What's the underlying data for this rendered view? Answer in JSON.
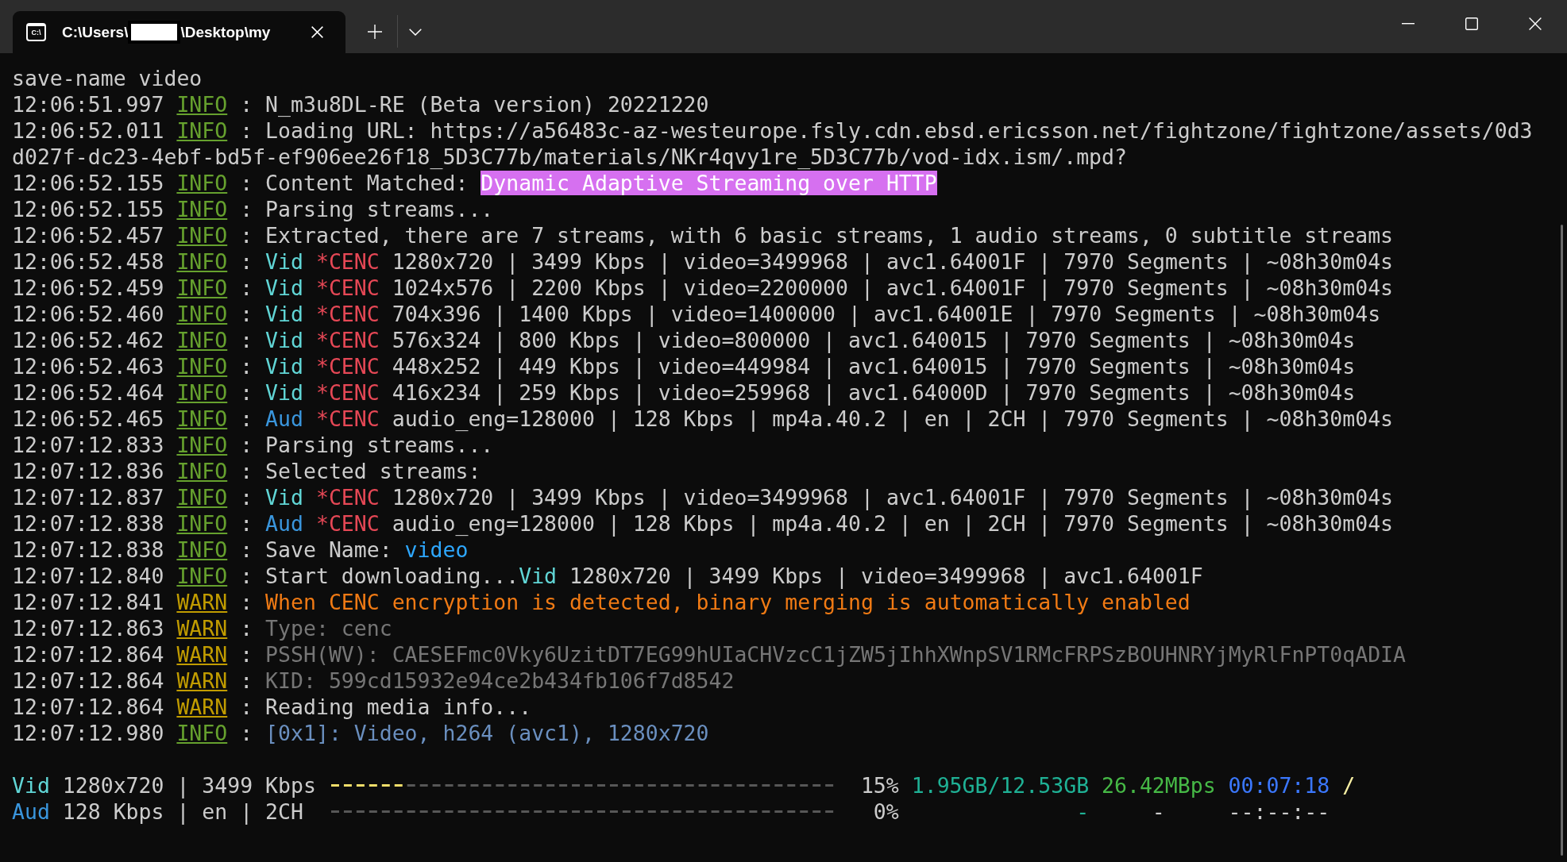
{
  "window": {
    "tab": {
      "selected": true,
      "icon_label": "C:\\",
      "title_start": "C:\\Users\\",
      "redacted": true,
      "title_end": "\\Desktop\\my"
    }
  },
  "lines": [
    {
      "segments": [
        {
          "kind": "plain",
          "text": "save-name video"
        }
      ]
    },
    {
      "segments": [
        {
          "kind": "time",
          "text": "12:06:51.997"
        },
        {
          "kind": "level_info",
          "text": "INFO"
        },
        {
          "kind": "separator",
          "text": ":"
        },
        {
          "kind": "plain",
          "text": "N_m3u8DL-RE (Beta version) 20221220"
        }
      ]
    },
    {
      "segments": [
        {
          "kind": "time",
          "text": "12:06:52.011"
        },
        {
          "kind": "level_info",
          "text": "INFO"
        },
        {
          "kind": "separator",
          "text": ":"
        },
        {
          "kind": "plain",
          "text": "Loading URL: https://a56483c-az-westeurope.fsly.cdn.ebsd.ericsson.net/fightzone/fightzone/assets/0d3"
        }
      ]
    },
    {
      "segments": [
        {
          "kind": "plain",
          "text": "d027f-dc23-4ebf-bd5f-ef906ee26f18_5D3C77b/materials/NKr4qvy1re_5D3C77b/vod-idx.ism/.mpd?"
        }
      ]
    },
    {
      "segments": [
        {
          "kind": "time",
          "text": "12:06:52.155"
        },
        {
          "kind": "level_info",
          "text": "INFO"
        },
        {
          "kind": "separator",
          "text": ":"
        },
        {
          "kind": "plain",
          "text": "Content Matched:"
        },
        {
          "kind": "highlight",
          "text": "Dynamic Adaptive Streaming over HTTP"
        }
      ]
    },
    {
      "segments": [
        {
          "kind": "time",
          "text": "12:06:52.155"
        },
        {
          "kind": "level_info",
          "text": "INFO"
        },
        {
          "kind": "separator",
          "text": ":"
        },
        {
          "kind": "plain",
          "text": "Parsing streams..."
        }
      ]
    },
    {
      "segments": [
        {
          "kind": "time",
          "text": "12:06:52.457"
        },
        {
          "kind": "level_info",
          "text": "INFO"
        },
        {
          "kind": "separator",
          "text": ":"
        },
        {
          "kind": "plain",
          "text": "Extracted, there are 7 streams, with 6 basic streams, 1 audio streams, 0 subtitle streams"
        }
      ]
    },
    {
      "segments": [
        {
          "kind": "time",
          "text": "12:06:52.458"
        },
        {
          "kind": "level_info",
          "text": "INFO"
        },
        {
          "kind": "separator",
          "text": ":"
        },
        {
          "kind": "video",
          "text": "Vid"
        },
        {
          "kind": "encryption",
          "text": "*CENC"
        },
        {
          "kind": "plain",
          "text": "1280x720 | 3499 Kbps | video=3499968 | avc1.64001F | 7970 Segments | ~08h30m04s"
        }
      ]
    },
    {
      "segments": [
        {
          "kind": "time",
          "text": "12:06:52.459"
        },
        {
          "kind": "level_info",
          "text": "INFO"
        },
        {
          "kind": "separator",
          "text": ":"
        },
        {
          "kind": "video",
          "text": "Vid"
        },
        {
          "kind": "encryption",
          "text": "*CENC"
        },
        {
          "kind": "plain",
          "text": "1024x576 | 2200 Kbps | video=2200000 | avc1.64001F | 7970 Segments | ~08h30m04s"
        }
      ]
    },
    {
      "segments": [
        {
          "kind": "time",
          "text": "12:06:52.460"
        },
        {
          "kind": "level_info",
          "text": "INFO"
        },
        {
          "kind": "separator",
          "text": ":"
        },
        {
          "kind": "video",
          "text": "Vid"
        },
        {
          "kind": "encryption",
          "text": "*CENC"
        },
        {
          "kind": "plain",
          "text": "704x396 | 1400 Kbps | video=1400000 | avc1.64001E | 7970 Segments | ~08h30m04s"
        }
      ]
    },
    {
      "segments": [
        {
          "kind": "time",
          "text": "12:06:52.462"
        },
        {
          "kind": "level_info",
          "text": "INFO"
        },
        {
          "kind": "separator",
          "text": ":"
        },
        {
          "kind": "video",
          "text": "Vid"
        },
        {
          "kind": "encryption",
          "text": "*CENC"
        },
        {
          "kind": "plain",
          "text": "576x324 | 800 Kbps | video=800000 | avc1.640015 | 7970 Segments | ~08h30m04s"
        }
      ]
    },
    {
      "segments": [
        {
          "kind": "time",
          "text": "12:06:52.463"
        },
        {
          "kind": "level_info",
          "text": "INFO"
        },
        {
          "kind": "separator",
          "text": ":"
        },
        {
          "kind": "video",
          "text": "Vid"
        },
        {
          "kind": "encryption",
          "text": "*CENC"
        },
        {
          "kind": "plain",
          "text": "448x252 | 449 Kbps | video=449984 | avc1.640015 | 7970 Segments | ~08h30m04s"
        }
      ]
    },
    {
      "segments": [
        {
          "kind": "time",
          "text": "12:06:52.464"
        },
        {
          "kind": "level_info",
          "text": "INFO"
        },
        {
          "kind": "separator",
          "text": ":"
        },
        {
          "kind": "video",
          "text": "Vid"
        },
        {
          "kind": "encryption",
          "text": "*CENC"
        },
        {
          "kind": "plain",
          "text": "416x234 | 259 Kbps | video=259968 | avc1.64000D | 7970 Segments | ~08h30m04s"
        }
      ]
    },
    {
      "segments": [
        {
          "kind": "time",
          "text": "12:06:52.465"
        },
        {
          "kind": "level_info",
          "text": "INFO"
        },
        {
          "kind": "separator",
          "text": ":"
        },
        {
          "kind": "audio",
          "text": "Aud"
        },
        {
          "kind": "encryption",
          "text": "*CENC"
        },
        {
          "kind": "plain",
          "text": "audio_eng=128000 | 128 Kbps | mp4a.40.2 | en | 2CH | 7970 Segments | ~08h30m04s"
        }
      ]
    },
    {
      "segments": [
        {
          "kind": "time",
          "text": "12:07:12.833"
        },
        {
          "kind": "level_info",
          "text": "INFO"
        },
        {
          "kind": "separator",
          "text": ":"
        },
        {
          "kind": "plain",
          "text": "Parsing streams..."
        }
      ]
    },
    {
      "segments": [
        {
          "kind": "time",
          "text": "12:07:12.836"
        },
        {
          "kind": "level_info",
          "text": "INFO"
        },
        {
          "kind": "separator",
          "text": ":"
        },
        {
          "kind": "plain",
          "text": "Selected streams:"
        }
      ]
    },
    {
      "segments": [
        {
          "kind": "time",
          "text": "12:07:12.837"
        },
        {
          "kind": "level_info",
          "text": "INFO"
        },
        {
          "kind": "separator",
          "text": ":"
        },
        {
          "kind": "video",
          "text": "Vid"
        },
        {
          "kind": "encryption",
          "text": "*CENC"
        },
        {
          "kind": "plain",
          "text": "1280x720 | 3499 Kbps | video=3499968 | avc1.64001F | 7970 Segments | ~08h30m04s"
        }
      ]
    },
    {
      "segments": [
        {
          "kind": "time",
          "text": "12:07:12.838"
        },
        {
          "kind": "level_info",
          "text": "INFO"
        },
        {
          "kind": "separator",
          "text": ":"
        },
        {
          "kind": "audio",
          "text": "Aud"
        },
        {
          "kind": "encryption",
          "text": "*CENC"
        },
        {
          "kind": "plain",
          "text": "audio_eng=128000 | 128 Kbps | mp4a.40.2 | en | 2CH | 7970 Segments | ~08h30m04s"
        }
      ]
    },
    {
      "segments": [
        {
          "kind": "time",
          "text": "12:07:12.838"
        },
        {
          "kind": "level_info",
          "text": "INFO"
        },
        {
          "kind": "separator",
          "text": ":"
        },
        {
          "kind": "plain",
          "text": "Save Name:"
        },
        {
          "kind": "name",
          "text": "video"
        }
      ]
    },
    {
      "segments": [
        {
          "kind": "time",
          "text": "12:07:12.840"
        },
        {
          "kind": "level_info",
          "text": "INFO"
        },
        {
          "kind": "separator",
          "text": ":"
        },
        {
          "kind": "plain",
          "text": "Start downloading..."
        },
        {
          "kind": "video",
          "text": "Vid",
          "glued": true
        },
        {
          "kind": "plain",
          "text": "1280x720 | 3499 Kbps | video=3499968 | avc1.64001F"
        }
      ]
    },
    {
      "segments": [
        {
          "kind": "time",
          "text": "12:07:12.841"
        },
        {
          "kind": "level_warn",
          "text": "WARN"
        },
        {
          "kind": "separator",
          "text": ":"
        },
        {
          "kind": "warning",
          "text": "When CENC encryption is detected, binary merging is automatically enabled"
        }
      ]
    },
    {
      "segments": [
        {
          "kind": "time",
          "text": "12:07:12.863"
        },
        {
          "kind": "level_warn",
          "text": "WARN"
        },
        {
          "kind": "separator",
          "text": ":"
        },
        {
          "kind": "muted",
          "text": "Type: cenc"
        }
      ]
    },
    {
      "segments": [
        {
          "kind": "time",
          "text": "12:07:12.864"
        },
        {
          "kind": "level_warn",
          "text": "WARN"
        },
        {
          "kind": "separator",
          "text": ":"
        },
        {
          "kind": "muted",
          "text": "PSSH(WV): CAESEFmc0Vky6UzitDT7EG99hUIaCHVzcC1jZW5jIhhXWnpSV1RMcFRPSzBOUHNRYjMyRlFnPT0qADIA"
        }
      ]
    },
    {
      "segments": [
        {
          "kind": "time",
          "text": "12:07:12.864"
        },
        {
          "kind": "level_warn",
          "text": "WARN"
        },
        {
          "kind": "separator",
          "text": ":"
        },
        {
          "kind": "muted",
          "text": "KID: 599cd15932e94ce2b434fb106f7d8542"
        }
      ]
    },
    {
      "segments": [
        {
          "kind": "time",
          "text": "12:07:12.864"
        },
        {
          "kind": "level_warn",
          "text": "WARN"
        },
        {
          "kind": "separator",
          "text": ":"
        },
        {
          "kind": "plain",
          "text": "Reading media info..."
        }
      ]
    },
    {
      "segments": [
        {
          "kind": "time",
          "text": "12:07:12.980"
        },
        {
          "kind": "level_info",
          "text": "INFO"
        },
        {
          "kind": "separator",
          "text": ":"
        },
        {
          "kind": "media",
          "text": "[0x1]: Video, h264 (avc1), 1280x720"
        }
      ]
    }
  ],
  "progress": [
    {
      "kind": "video",
      "stream_label": "Vid",
      "description": "1280x720 | 3499 Kbps",
      "level": 0.15,
      "percent": "15%",
      "size": "1.95GB/12.53GB",
      "speed": "26.42MBps",
      "elapsed": "00:07:18",
      "active": true,
      "spinner": "/"
    },
    {
      "kind": "audio",
      "stream_label": "Aud",
      "description": "128 Kbps | en | 2CH",
      "level": 0,
      "percent": "0%",
      "size": "-",
      "speed": "-",
      "elapsed": "--:--:--",
      "active": false
    }
  ]
}
